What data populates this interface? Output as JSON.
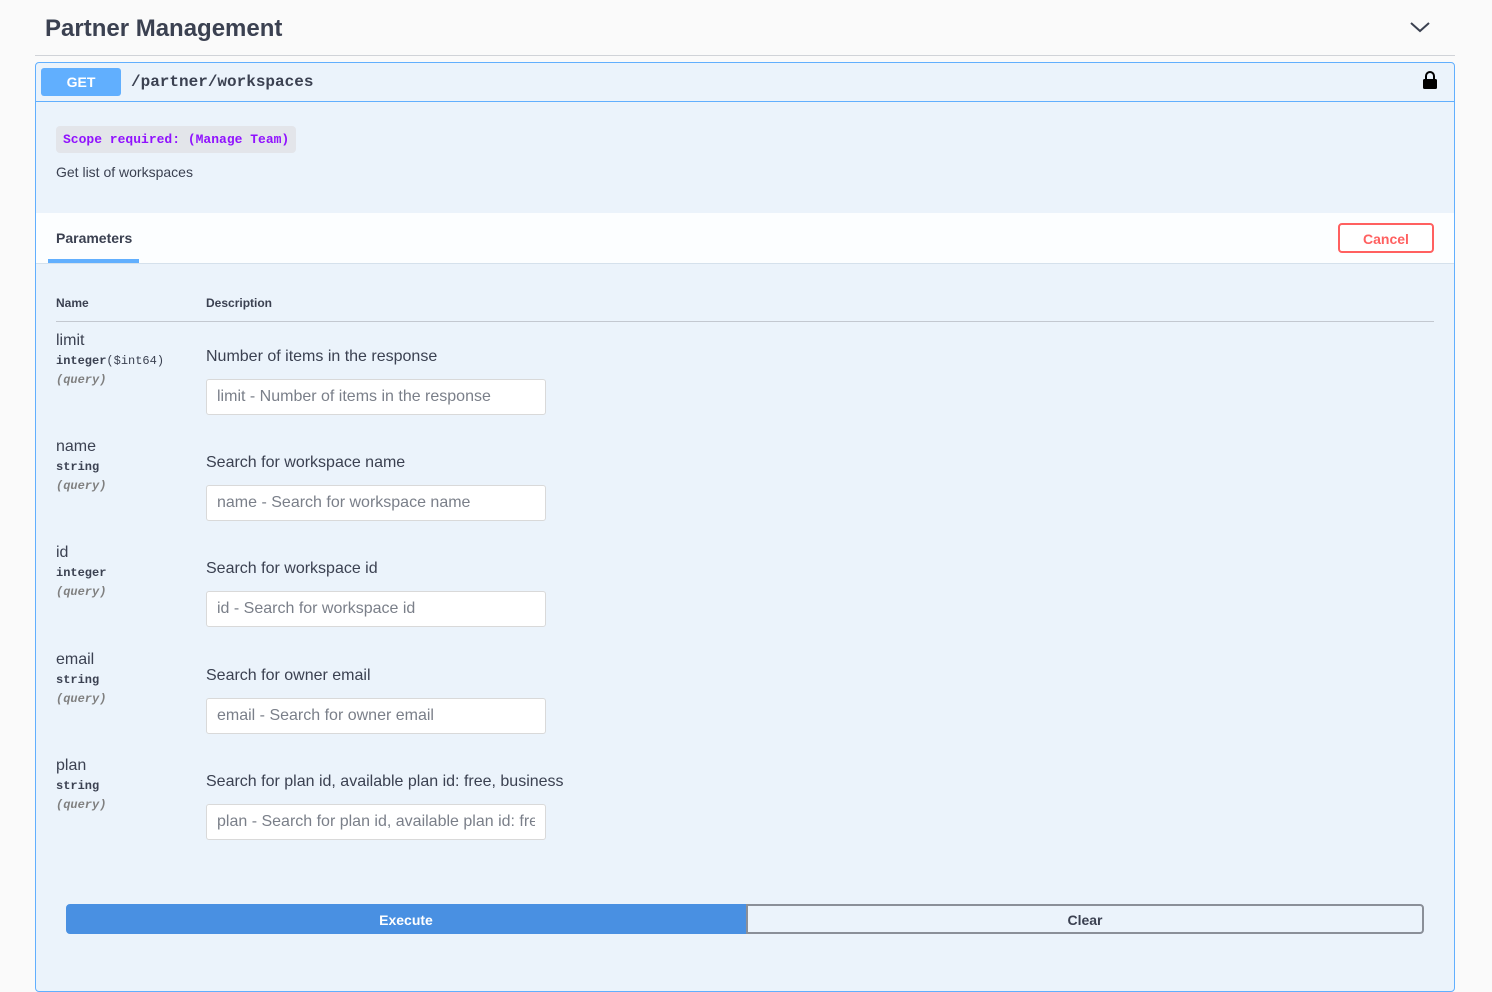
{
  "tag": {
    "title": "Partner Management"
  },
  "operation": {
    "method": "GET",
    "path": "/partner/workspaces",
    "scope": "Scope required: (Manage Team)",
    "description": "Get list of workspaces"
  },
  "tabs": {
    "parameters": "Parameters",
    "cancel": "Cancel"
  },
  "table": {
    "name_header": "Name",
    "description_header": "Description"
  },
  "params": [
    {
      "name": "limit",
      "type": "integer",
      "format": "($int64)",
      "in": "(query)",
      "description": "Number of items in the response",
      "placeholder": "limit - Number of items in the response"
    },
    {
      "name": "name",
      "type": "string",
      "format": "",
      "in": "(query)",
      "description": "Search for workspace name",
      "placeholder": "name - Search for workspace name"
    },
    {
      "name": "id",
      "type": "integer",
      "format": "",
      "in": "(query)",
      "description": "Search for workspace id",
      "placeholder": "id - Search for workspace id"
    },
    {
      "name": "email",
      "type": "string",
      "format": "",
      "in": "(query)",
      "description": "Search for owner email",
      "placeholder": "email - Search for owner email"
    },
    {
      "name": "plan",
      "type": "string",
      "format": "",
      "in": "(query)",
      "description": "Search for plan id, available plan id: free, business",
      "placeholder": "plan - Search for plan id, available plan id: free, business"
    }
  ],
  "actions": {
    "execute": "Execute",
    "clear": "Clear"
  },
  "icons": {
    "collapse": "chevron-down-icon",
    "auth": "lock-icon"
  },
  "colors": {
    "get": "#61affe",
    "execute": "#4990e2",
    "cancel": "#ff6060",
    "scope": "#9012fe"
  }
}
